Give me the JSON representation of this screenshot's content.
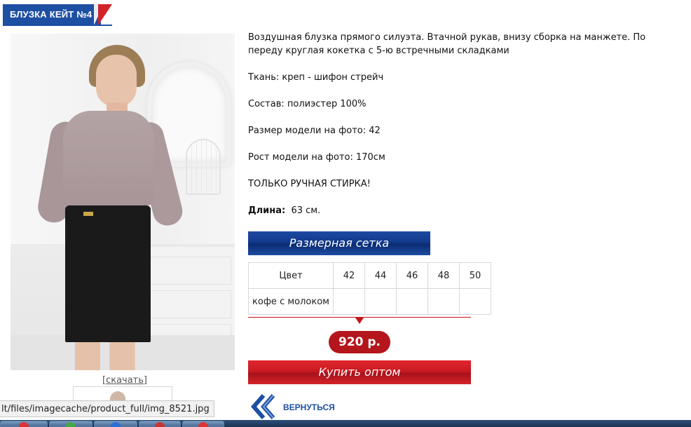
{
  "product": {
    "title": "БЛУЗКА КЕЙТ №4",
    "download_label": "[скачать]",
    "description": "Воздушная блузка прямого силуэта. Втачной рукав, внизу сборка на манжете. По переду круглая кокетка с 5-ю встречными складками",
    "fabric": "Ткань: креп - шифон стрейч",
    "composition": "Состав:  полиэстер 100%",
    "model_size": "Размер модели на фото: 42",
    "model_height": "Рост модели на фото: 170см",
    "care": "ТОЛЬКО РУЧНАЯ СТИРКА!",
    "length_label": "Длина:",
    "length_value": "63 см."
  },
  "size_chart_button": "Размерная сетка",
  "sizes_table": {
    "header_color": "Цвет",
    "sizes": [
      "42",
      "44",
      "46",
      "48",
      "50"
    ],
    "rows": [
      {
        "color": "кофе с молоком",
        "cells": [
          "",
          "",
          "",
          "",
          ""
        ]
      }
    ]
  },
  "price": "920 р.",
  "buy_button": "Купить оптом",
  "back_label": "ВЕРНУТЬСЯ",
  "status_url": "lt/files/imagecache/product_full/img_8521.jpg",
  "colors": {
    "brand_blue": "#1d4fa3",
    "accent_red": "#c7151c",
    "price_badge": "#b4161c"
  },
  "icons": {
    "back": "double-chevron-left-icon"
  }
}
